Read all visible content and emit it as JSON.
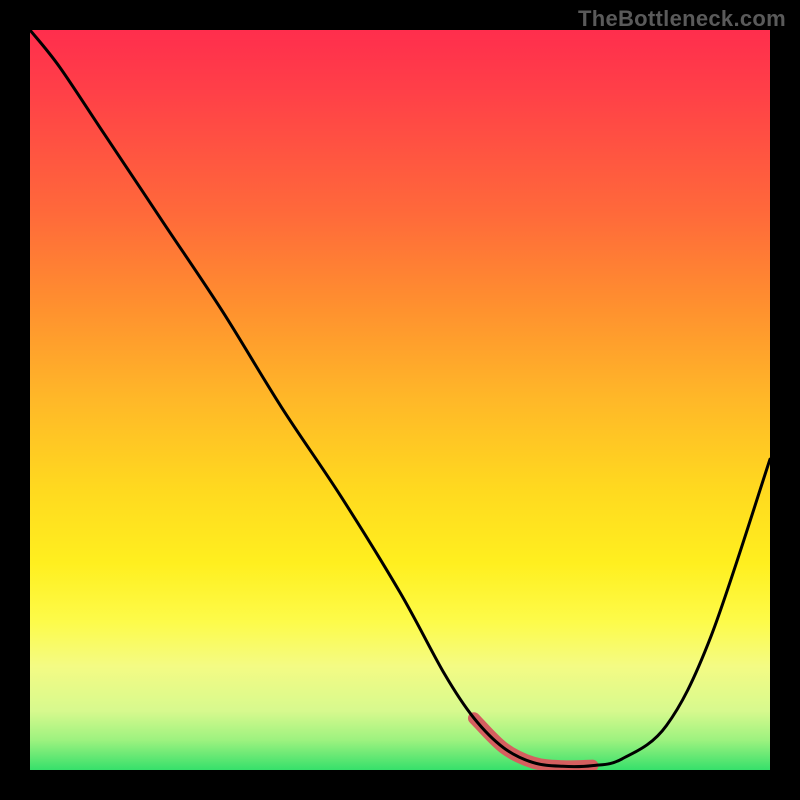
{
  "watermark": "TheBottleneck.com",
  "chart_data": {
    "type": "line",
    "title": "",
    "xlabel": "",
    "ylabel": "",
    "xlim": [
      0,
      100
    ],
    "ylim": [
      0,
      100
    ],
    "grid": false,
    "legend": false,
    "series": [
      {
        "name": "bottleneck-curve",
        "x": [
          0,
          4,
          10,
          18,
          26,
          34,
          42,
          50,
          56,
          60,
          64,
          68,
          72,
          76,
          80,
          86,
          92,
          100
        ],
        "y": [
          100,
          95,
          86,
          74,
          62,
          49,
          37,
          24,
          13,
          7,
          3,
          1,
          0.5,
          0.6,
          1.5,
          6,
          18,
          42
        ]
      }
    ],
    "highlight_range_x": [
      60,
      76
    ],
    "background_gradient": {
      "top": "#ff2e4d",
      "mid": "#ffef1f",
      "bottom": "#36e06b"
    }
  }
}
